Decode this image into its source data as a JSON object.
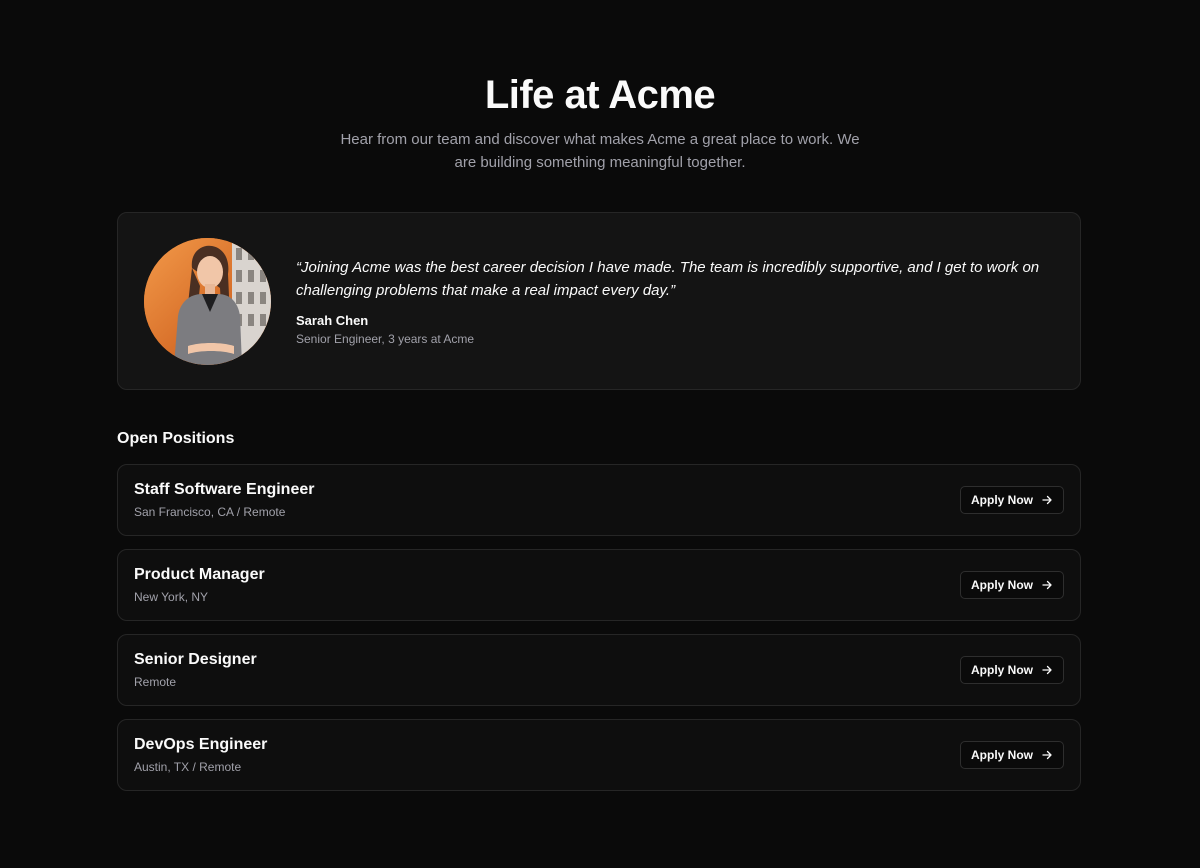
{
  "hero": {
    "title": "Life at Acme",
    "subtitle": "Hear from our team and discover what makes Acme a great place to work. We are building something meaningful together."
  },
  "testimonial": {
    "quote": "“Joining Acme was the best career decision I have made. The team is incredibly supportive, and I get to work on challenging problems that make a real impact every day.”",
    "author_name": "Sarah Chen",
    "author_role": "Senior Engineer, 3 years at Acme",
    "avatar_icon": "person-photo"
  },
  "positions": {
    "title": "Open Positions",
    "jobs": [
      {
        "title": "Staff Software Engineer",
        "location": "San Francisco, CA / Remote",
        "button": "Apply Now"
      },
      {
        "title": "Product Manager",
        "location": "New York, NY",
        "button": "Apply Now"
      },
      {
        "title": "Senior Designer",
        "location": "Remote",
        "button": "Apply Now"
      },
      {
        "title": "DevOps Engineer",
        "location": "Austin, TX / Remote",
        "button": "Apply Now"
      }
    ]
  },
  "colors": {
    "background": "#0a0a0a",
    "card": "#141414",
    "border": "#262626",
    "text": "#fafafa",
    "muted": "#a1a1aa",
    "avatar_accent": "#e07a2e"
  }
}
